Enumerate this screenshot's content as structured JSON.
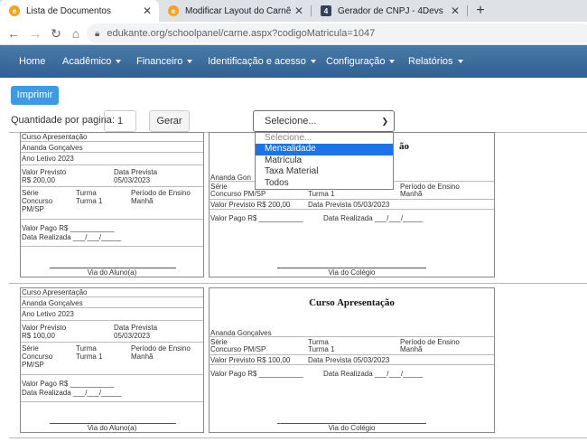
{
  "browser": {
    "tabs": [
      {
        "title": "Lista de Documentos",
        "active": true
      },
      {
        "title": "Modificar Layout do Carnê",
        "active": false
      },
      {
        "title": "Gerador de CNPJ - 4Devs",
        "active": false
      }
    ],
    "close_glyph": "✕",
    "new_tab_glyph": "+",
    "url": "edukante.org/schoolpanel/carne.aspx?codigoMatricula=1047"
  },
  "nav": {
    "items": [
      "Home",
      "Acadêmico",
      "Financeiro",
      "Identificação e acesso",
      "Configuração",
      "Relatórios"
    ]
  },
  "controls": {
    "print_label": "Imprimir",
    "qty_label": "Quantidade por pagina:",
    "qty_value": "1",
    "generate_label": "Gerar",
    "select_value": "Selecione...",
    "options": [
      "Selecione...",
      "Mensalidade",
      "Matrícula",
      "Taxa Material",
      "Todos"
    ],
    "selected_option_index": 1
  },
  "cards": {
    "course": "Curso Apresentação",
    "student": "Ananda Gonçalves",
    "year": "Ano Letivo 2023",
    "lbl_valor": "Valor Previsto",
    "lbl_data": "Data Prevista",
    "lbl_serie": "Série",
    "lbl_turma": "Turma",
    "lbl_periodo": "Período de Ensino",
    "serie_value": "Concurso PM/SP",
    "serie_line1": "Concurso",
    "serie_line2": "PM/SP",
    "turma_value": "Turma 1",
    "periodo_value": "Manhã",
    "pago": "Valor Pago R$ ___________",
    "realizada": "Data Realizada ___/___/_____",
    "pago_inline": "Valor Pago R$ ___________",
    "realizada_inline": "Data Realizada ___/___/_____",
    "via_aluno": "Via do Aluno(a)",
    "via_colegio": "Via do Colégio",
    "partial_title": "ão",
    "partial_student": "Ananda Gon",
    "installments": [
      {
        "valor": "R$ 200,00",
        "valor_inline": "Valor Previsto R$ 200,00",
        "data": "05/03/2023",
        "data_inline": "Data Prevista 05/03/2023"
      },
      {
        "valor": "R$ 100,00",
        "valor_inline": "Valor Previsto R$ 100,00",
        "data": "05/03/2023",
        "data_inline": "Data Prevista 05/03/2023"
      }
    ]
  }
}
